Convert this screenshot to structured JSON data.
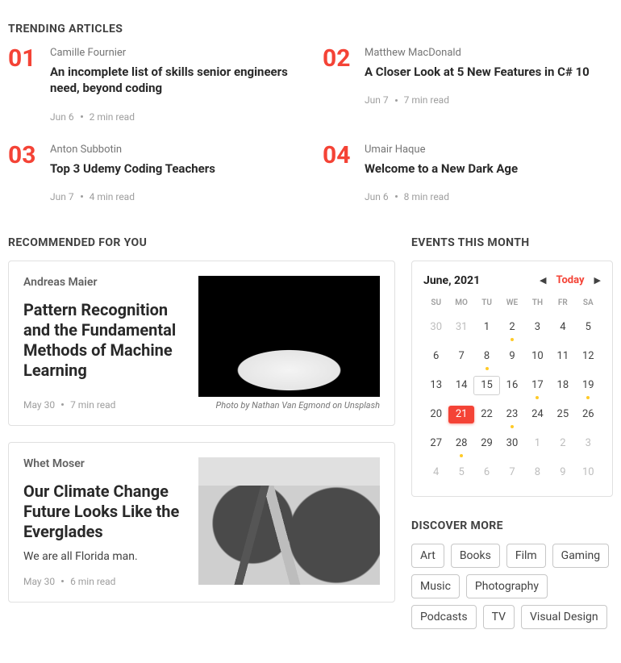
{
  "sections": {
    "trending_title": "TRENDING ARTICLES",
    "recommended_title": "RECOMMENDED FOR YOU",
    "events_title": "EVENTS THIS MONTH",
    "discover_title": "DISCOVER MORE"
  },
  "trending": [
    {
      "rank": "01",
      "author": "Camille Fournier",
      "title": "An incomplete list of skills senior engineers need, beyond coding",
      "date": "Jun 6",
      "read": "2 min read"
    },
    {
      "rank": "02",
      "author": "Matthew MacDonald",
      "title": "A Closer Look at 5 New Features in C# 10",
      "date": "Jun 7",
      "read": "7 min read"
    },
    {
      "rank": "03",
      "author": "Anton Subbotin",
      "title": "Top 3 Udemy Coding Teachers",
      "date": "Jun 7",
      "read": "4 min read"
    },
    {
      "rank": "04",
      "author": "Umair Haque",
      "title": "Welcome to a New Dark Age",
      "date": "Jun 6",
      "read": "8 min read"
    }
  ],
  "recommended": [
    {
      "author": "Andreas Maier",
      "title": "Pattern Recognition and the Fundamental Methods of Machine Learning",
      "subtitle": "",
      "date": "May 30",
      "read": "7 min read",
      "credit": "Photo by Nathan Van Egmond on Unsplash"
    },
    {
      "author": "Whet Moser",
      "title": "Our Climate Change Future Looks Like the Everglades",
      "subtitle": "We are all Florida man.",
      "date": "May 30",
      "read": "6 min read",
      "credit": ""
    }
  ],
  "calendar": {
    "month_label": "June, 2021",
    "today_label": "Today",
    "dow": [
      "SU",
      "MO",
      "TU",
      "WE",
      "TH",
      "FR",
      "SA"
    ],
    "cells": [
      {
        "n": "30",
        "out": true
      },
      {
        "n": "31",
        "out": true
      },
      {
        "n": "1"
      },
      {
        "n": "2",
        "dot": true
      },
      {
        "n": "3"
      },
      {
        "n": "4"
      },
      {
        "n": "5"
      },
      {
        "n": "6"
      },
      {
        "n": "7"
      },
      {
        "n": "8",
        "dot": true
      },
      {
        "n": "9"
      },
      {
        "n": "10"
      },
      {
        "n": "11"
      },
      {
        "n": "12"
      },
      {
        "n": "13"
      },
      {
        "n": "14"
      },
      {
        "n": "15",
        "outlined": true
      },
      {
        "n": "16"
      },
      {
        "n": "17",
        "dot": true
      },
      {
        "n": "18"
      },
      {
        "n": "19",
        "dot": true
      },
      {
        "n": "20"
      },
      {
        "n": "21",
        "selected": true
      },
      {
        "n": "22"
      },
      {
        "n": "23",
        "dot": true
      },
      {
        "n": "24"
      },
      {
        "n": "25"
      },
      {
        "n": "26"
      },
      {
        "n": "27"
      },
      {
        "n": "28",
        "dot": true
      },
      {
        "n": "29"
      },
      {
        "n": "30"
      },
      {
        "n": "1",
        "out": true
      },
      {
        "n": "2",
        "out": true
      },
      {
        "n": "3",
        "out": true
      },
      {
        "n": "4",
        "out": true
      },
      {
        "n": "5",
        "out": true
      },
      {
        "n": "6",
        "out": true
      },
      {
        "n": "7",
        "out": true
      },
      {
        "n": "8",
        "out": true
      },
      {
        "n": "9",
        "out": true
      },
      {
        "n": "10",
        "out": true
      }
    ]
  },
  "discover": [
    "Art",
    "Books",
    "Film",
    "Gaming",
    "Music",
    "Photography",
    "Podcasts",
    "TV",
    "Visual Design"
  ]
}
